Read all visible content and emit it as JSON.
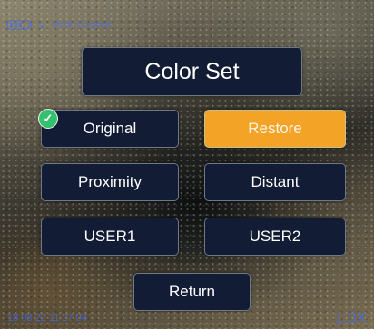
{
  "status_bar": {
    "mode_label": "Mode:Original"
  },
  "title": "Color Set",
  "buttons": {
    "original": "Original",
    "restore": "Restore",
    "proximity": "Proximity",
    "distant": "Distant",
    "user1": "USER1",
    "user2": "USER2",
    "return": "Return"
  },
  "selected_preset": "Original",
  "footer": {
    "datetime": "18 08 22 11 27 04",
    "zoom": "1.0X"
  },
  "icons": {
    "battery": "battery-icon",
    "wifi": "wifi-icon",
    "check": "check-icon"
  },
  "colors": {
    "highlight": "#f3a325",
    "panel": "#121c34",
    "check": "#35c070",
    "osd_text": "#3d6cff"
  }
}
